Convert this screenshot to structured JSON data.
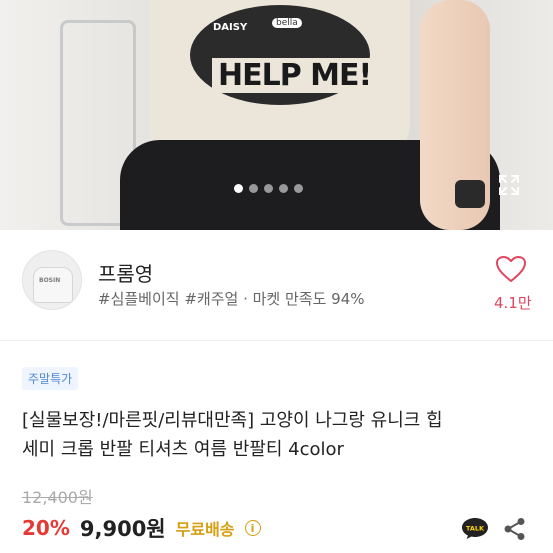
{
  "hero": {
    "print_text": "HELP ME!",
    "print_name1": "DAISY",
    "print_name2": "bella",
    "carousel": {
      "count": 5,
      "active": 0
    },
    "expand_icon": "expand-icon"
  },
  "seller": {
    "name": "프롬영",
    "meta": "#심플베이직 #캐주얼 · 마켓 만족도 94%",
    "likes": "4.1만",
    "avatar_text": "BOSIN"
  },
  "product": {
    "badge": "주말특가",
    "title_line1": "[실물보장!/마른핏/리뷰대만족] 고양이 나그랑 유니크 힙",
    "title_line2": "세미 크롭 반팔 티셔츠 여름 반팔티 4color",
    "original_price": "12,400원",
    "discount": "20%",
    "price": "9,900원",
    "shipping": "무료배송",
    "info_icon": "i"
  },
  "actions": {
    "talk_label": "TALK",
    "share_icon": "share-icon"
  },
  "colors": {
    "discount": "#e53935",
    "heart": "#e0475e",
    "shipping": "#d4a012",
    "badge_bg": "#eef5ff",
    "badge_text": "#4d86d6"
  }
}
